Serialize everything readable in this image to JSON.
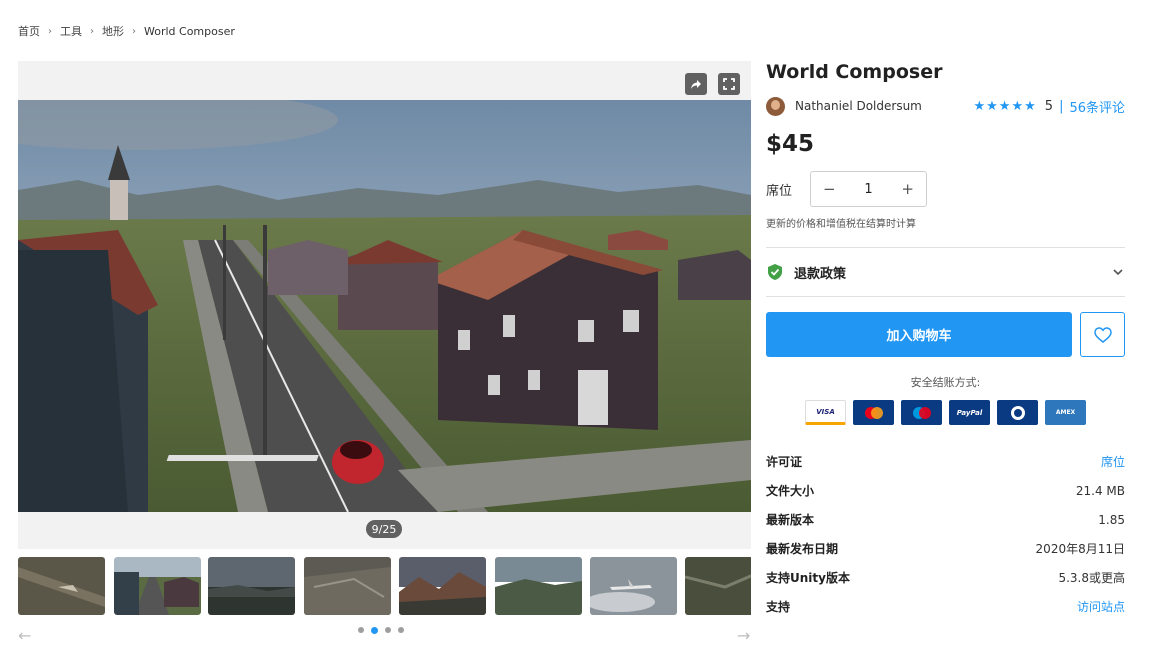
{
  "breadcrumb": {
    "items": [
      "首页",
      "工具",
      "地形"
    ],
    "current": "World Composer"
  },
  "gallery": {
    "counter": "9/25",
    "share_icon": "share-icon",
    "fullscreen_icon": "fullscreen-icon",
    "thumbnails": [
      "aerial-river-view",
      "town-street-view",
      "dusk-hills-view",
      "dry-terrain-view",
      "mountains-sunset-view",
      "green-hills-view",
      "airplane-clouds-view",
      "satellite-terrain-view"
    ],
    "dots": 4,
    "active_dot": 1
  },
  "product": {
    "title": "World Composer",
    "seller": "Nathaniel Doldersum",
    "stars": "★★★★★",
    "rating": "5",
    "rating_separator": "|",
    "reviews": "56条评论",
    "price": "$45",
    "seat_label": "席位",
    "quantity": "1",
    "minus": "−",
    "plus": "+",
    "price_note": "更新的价格和增值税在结算时计算",
    "refund_label": "退款政策",
    "add_to_cart": "加入购物车",
    "secure_checkout": "安全结账方式:",
    "payment_methods": [
      "VISA",
      "Mastercard",
      "Maestro",
      "PayPal",
      "Diners",
      "AMEX"
    ]
  },
  "details": [
    {
      "key": "许可证",
      "value": "席位",
      "link": true
    },
    {
      "key": "文件大小",
      "value": "21.4 MB",
      "link": false
    },
    {
      "key": "最新版本",
      "value": "1.85",
      "link": false
    },
    {
      "key": "最新发布日期",
      "value": "2020年8月11日",
      "link": false
    },
    {
      "key": "支持Unity版本",
      "value": "5.3.8或更高",
      "link": false
    },
    {
      "key": "支持",
      "value": "访问站点",
      "link": true
    }
  ],
  "colors": {
    "accent": "#2196f3",
    "refund_check": "#43a047"
  }
}
